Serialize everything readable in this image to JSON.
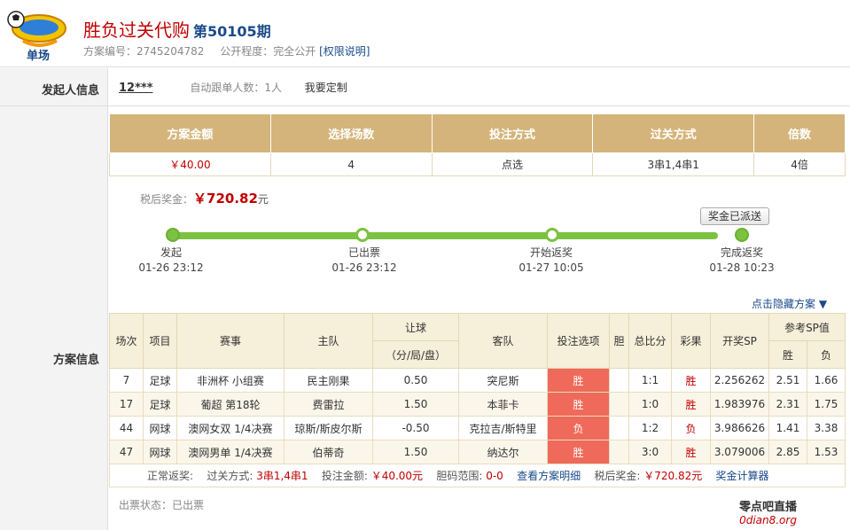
{
  "header": {
    "logo_text": "单场",
    "title": "胜负过关代购",
    "issue": "第50105期",
    "plan_no_label": "方案编号：",
    "plan_no": "2745204782",
    "public_label": "公开程度：",
    "public_value": "完全公开",
    "permission_link": "[权限说明]"
  },
  "labels": {
    "initiator": "发起人信息",
    "plan": "方案信息"
  },
  "initiator": {
    "username": "12***",
    "follow_text": "自动跟单人数：1人",
    "custom_text": "我要定制"
  },
  "summary": {
    "headers": [
      "方案金额",
      "选择场数",
      "投注方式",
      "过关方式",
      "倍数"
    ],
    "values": [
      "￥40.00",
      "4",
      "点选",
      "3串1,4串1",
      "4倍"
    ]
  },
  "bonus": {
    "label": "税后奖金：",
    "value": "￥720.82",
    "unit": "元"
  },
  "paid_button": "奖金已派送",
  "progress": [
    {
      "label": "发起",
      "time": "01-26 23:12"
    },
    {
      "label": "已出票",
      "time": "01-26 23:12"
    },
    {
      "label": "开始返奖",
      "time": "01-27 10:05"
    },
    {
      "label": "完成返奖",
      "time": "01-28 10:23"
    }
  ],
  "hide_link": "点击隐藏方案 ▼",
  "detail": {
    "headers": {
      "round": "场次",
      "sport": "项目",
      "event": "赛事",
      "home": "主队",
      "handicap": "让球",
      "handicap_sub": "（分/局/盘）",
      "away": "客队",
      "pick": "投注选项",
      "dan": "胆",
      "score": "总比分",
      "result": "彩果",
      "sp": "开奖SP",
      "ref_sp": "参考SP值",
      "win": "胜",
      "lose": "负"
    },
    "rows": [
      {
        "round": "7",
        "sport": "足球",
        "event": "非洲杯 小组赛",
        "home": "民主刚果",
        "handicap": "0.50",
        "away": "突尼斯",
        "pick": "胜",
        "dan": "",
        "score": "1:1",
        "result": "胜",
        "sp": "2.256262",
        "win": "2.51",
        "lose": "1.66"
      },
      {
        "round": "17",
        "sport": "足球",
        "event": "葡超 第18轮",
        "home": "费雷拉",
        "handicap": "1.50",
        "away": "本菲卡",
        "pick": "胜",
        "dan": "",
        "score": "1:0",
        "result": "胜",
        "sp": "1.983976",
        "win": "2.31",
        "lose": "1.75"
      },
      {
        "round": "44",
        "sport": "网球",
        "event": "澳网女双 1/4决赛",
        "home": "琼斯/斯皮尔斯",
        "handicap": "-0.50",
        "away": "克拉吉/斯特里",
        "pick": "负",
        "dan": "",
        "score": "1:2",
        "result": "负",
        "sp": "3.986626",
        "win": "1.41",
        "lose": "3.38"
      },
      {
        "round": "47",
        "sport": "网球",
        "event": "澳网男单 1/4决赛",
        "home": "伯蒂奇",
        "handicap": "1.50",
        "away": "纳达尔",
        "pick": "胜",
        "dan": "",
        "score": "3:0",
        "result": "胜",
        "sp": "3.079006",
        "win": "2.85",
        "lose": "1.53"
      }
    ],
    "footer": {
      "normal": "正常返奖:",
      "pass_label": "过关方式:",
      "pass_value": "3串1,4串1",
      "amount_label": "投注金额:",
      "amount_value": "￥40.00元",
      "dan_label": "胆码范围:",
      "dan_value": "0-0",
      "detail_link": "查看方案明细",
      "bonus_label": "税后奖金:",
      "bonus_value": "￥720.82元",
      "calc_link": "奖金计算器"
    }
  },
  "ticket_status": "出票状态：已出票",
  "watermark": {
    "line1": "零点吧直播",
    "line2": "0dian8.org"
  },
  "colors": {
    "title_red": "#c10000",
    "header_gold": "#d4b47a",
    "progress_green": "#7cc241",
    "pick_red": "#ef6a5a",
    "link_blue": "#1a4a8a"
  }
}
